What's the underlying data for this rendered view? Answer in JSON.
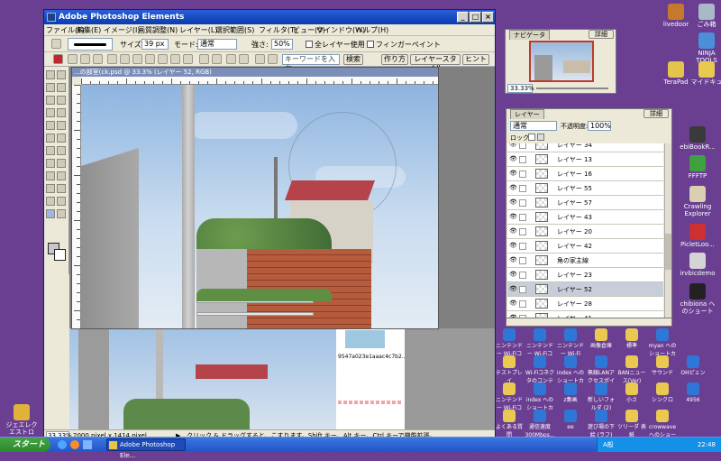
{
  "window": {
    "title": "Adobe Photoshop Elements",
    "menu": [
      "ファイル(F)",
      "編集(E)",
      "イメージ(I)",
      "画質調整(N)",
      "レイヤー(L)",
      "選択範囲(S)",
      "フィルタ(T)",
      "ビュー(V)",
      "ウインドウ(W)",
      "ヘルプ(H)"
    ]
  },
  "options": {
    "size_label": "サイズ:",
    "size_value": "39 px",
    "mode_label": "モード:",
    "mode_value": "通常",
    "opacity_label": "強さ:",
    "opacity_value": "50%",
    "all_layers": "全レイヤー使用",
    "finger_paint": "フィンガーペイント"
  },
  "shortcuts": {
    "search_placeholder": "キーワードを入力",
    "search_button": "検索",
    "tab1": "作り方",
    "tab2": "レイヤースタイル",
    "tab3": "ヒント"
  },
  "document": {
    "title": "...の部室(ck.psd @ 33.3% (レイヤー 52, RGB)",
    "zoom": "33.33%",
    "dimensions": "2000 pixel x 1414 pixel",
    "hint": "クリック & ドラッグすると、こすります。Shift キー、Alt キー、Ctrl キーで機能拡張。"
  },
  "navigator": {
    "tab": "ナビゲータ",
    "more": "詳細",
    "zoom": "33.33%"
  },
  "layers": {
    "tab": "レイヤー",
    "more": "詳細",
    "blend": "通常",
    "opacity_label": "不透明度:",
    "opacity_value": "100%",
    "lock_label": "ロック",
    "items": [
      {
        "name": "レイヤー 34"
      },
      {
        "name": "レイヤー 13"
      },
      {
        "name": "レイヤー 16"
      },
      {
        "name": "レイヤー 55"
      },
      {
        "name": "レイヤー 57"
      },
      {
        "name": "レイヤー 43"
      },
      {
        "name": "レイヤー 20"
      },
      {
        "name": "レイヤー 42"
      },
      {
        "name": "角の家主線"
      },
      {
        "name": "レイヤー 23"
      },
      {
        "name": "レイヤー 52",
        "selected": true
      },
      {
        "name": "レイヤー 28"
      },
      {
        "name": "レイヤー 41"
      }
    ]
  },
  "desktop_left": [
    {
      "label": "ジェエレク エストロ"
    }
  ],
  "desktop_right": [
    {
      "label": "livedoor"
    },
    {
      "label": "ごみ箱"
    },
    {
      "label": "NINJA TOOLS"
    },
    {
      "label": "TeraPad"
    },
    {
      "label": "マイドキュ"
    },
    {
      "label": "ebiBookR..."
    },
    {
      "label": "FFFTP"
    },
    {
      "label": "Crawling Explorer"
    },
    {
      "label": "PicletLoo..."
    },
    {
      "label": "irvbicdemo"
    },
    {
      "label": "chibiona へのショート"
    }
  ],
  "desktop_bottom": [
    {
      "label": "ニンテンドー Wi-Fiコネ..."
    },
    {
      "label": "ニンテンドー Wi-Fiコネ..."
    },
    {
      "label": "ニンテンドー Wi-Fi US..."
    },
    {
      "label": "画像倉庫"
    },
    {
      "label": "標準"
    },
    {
      "label": "myan へのショートカット"
    },
    {
      "label": "テストプレイ"
    },
    {
      "label": "Wi-Fiコネクタのコンテ"
    },
    {
      "label": "index へのショートカット"
    },
    {
      "label": "無線LANアクセスポイント"
    },
    {
      "label": "ΒΑΝニュース(Ver)"
    },
    {
      "label": "サウンド"
    },
    {
      "label": "OHピェン"
    },
    {
      "label": "ニンテンドー Wi-Fiコネ"
    },
    {
      "label": "index へのショートカ"
    },
    {
      "label": "z集画"
    },
    {
      "label": "新しいフォルダ (2)"
    },
    {
      "label": "小さ"
    },
    {
      "label": "シンクロ"
    },
    {
      "label": "4956"
    },
    {
      "label": "よくある質問 WIRELES..."
    },
    {
      "label": "通信速度 300Mbps..."
    },
    {
      "label": "ee"
    },
    {
      "label": "遊び場の下 絵 (ラフ)"
    },
    {
      "label": "ツリーダ 表紙"
    },
    {
      "label": "crowwave へのショート"
    }
  ],
  "behind": {
    "filename": "9547a023e1aaac4c7b2..."
  },
  "taskbar": {
    "start": "スタート",
    "task": "Adobe Photoshop Ele...",
    "ime": "A般",
    "clock": "22:48"
  },
  "colors": {
    "desktop": "#6a3f92",
    "titlebar": "#0a3cb0",
    "taskbar": "#2457c9",
    "selected_layer": "#c7cdd9"
  }
}
